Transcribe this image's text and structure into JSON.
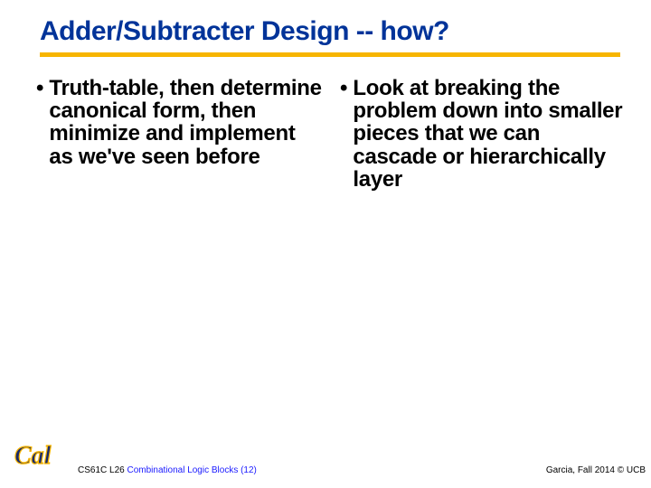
{
  "title": "Adder/Subtracter Design -- how?",
  "bullets": {
    "left": "Truth-table, then determine canonical form, then minimize and implement as we've seen before",
    "right": "Look at breaking the problem down into smaller pieces that we can cascade or hierarchically layer"
  },
  "footer": {
    "course": "CS61C L26 ",
    "lecture": "Combinational Logic Blocks (12)",
    "right": "Garcia, Fall 2014 © UCB"
  },
  "logo_text": "Cal",
  "colors": {
    "title": "#003399",
    "rule": "#f7b500",
    "logo_blue": "#1a2a6c",
    "logo_gold": "#f7b500"
  }
}
